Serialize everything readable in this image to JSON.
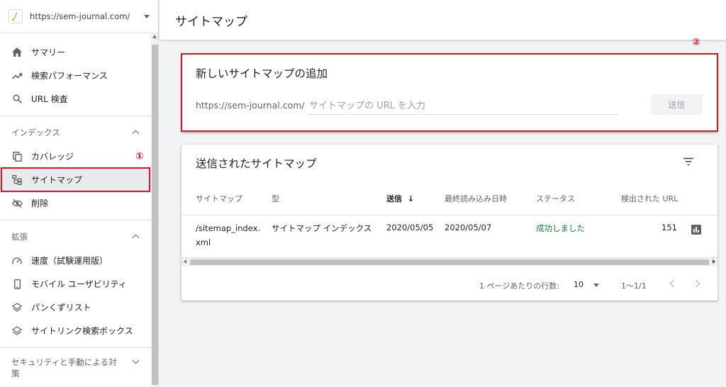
{
  "property": {
    "url": "https://sem-journal.com/"
  },
  "sidebar": {
    "items_top": [
      {
        "label": "サマリー",
        "icon": "home-icon"
      },
      {
        "label": "検索パフォーマンス",
        "icon": "trending-up-icon"
      },
      {
        "label": "URL 検査",
        "icon": "search-icon"
      }
    ],
    "section_index": "インデックス",
    "items_index": [
      {
        "label": "カバレッジ",
        "icon": "copy-icon"
      },
      {
        "label": "サイトマップ",
        "icon": "sitemap-icon"
      },
      {
        "label": "削除",
        "icon": "eye-off-icon"
      }
    ],
    "section_ext": "拡張",
    "items_ext": [
      {
        "label": "速度（試験運用版）",
        "icon": "speed-icon"
      },
      {
        "label": "モバイル ユーザビリティ",
        "icon": "smartphone-icon"
      },
      {
        "label": "パンくずリスト",
        "icon": "layers-icon"
      },
      {
        "label": "サイトリンク検索ボックス",
        "icon": "layers-icon"
      }
    ],
    "section_security": "セキュリティと手動による対策"
  },
  "markers": {
    "one": "①",
    "two": "②"
  },
  "page": {
    "title": "サイトマップ"
  },
  "add_card": {
    "title": "新しいサイトマップの追加",
    "url_prefix": "https://sem-journal.com/",
    "placeholder": "サイトマップの URL を入力",
    "value": "",
    "submit_label": "送信"
  },
  "submitted_card": {
    "title": "送信されたサイトマップ",
    "columns": [
      "サイトマップ",
      "型",
      "送信",
      "最終読み込み日時",
      "ステータス",
      "検出された URL"
    ],
    "sort_indicator": "↓",
    "rows": [
      {
        "sitemap_line1": "/sitemap_index.",
        "sitemap_line2": "xml",
        "type": "サイトマップ インデックス",
        "submitted": "2020/05/05",
        "last_read": "2020/05/07",
        "status": "成功しました",
        "discovered_urls": "151"
      }
    ],
    "pagination": {
      "rows_per_page_label": "1 ページあたりの行数:",
      "rows_per_page": "10",
      "range": "1～1/1"
    }
  },
  "colors": {
    "accent_red": "#e0141e",
    "success": "#188038"
  }
}
